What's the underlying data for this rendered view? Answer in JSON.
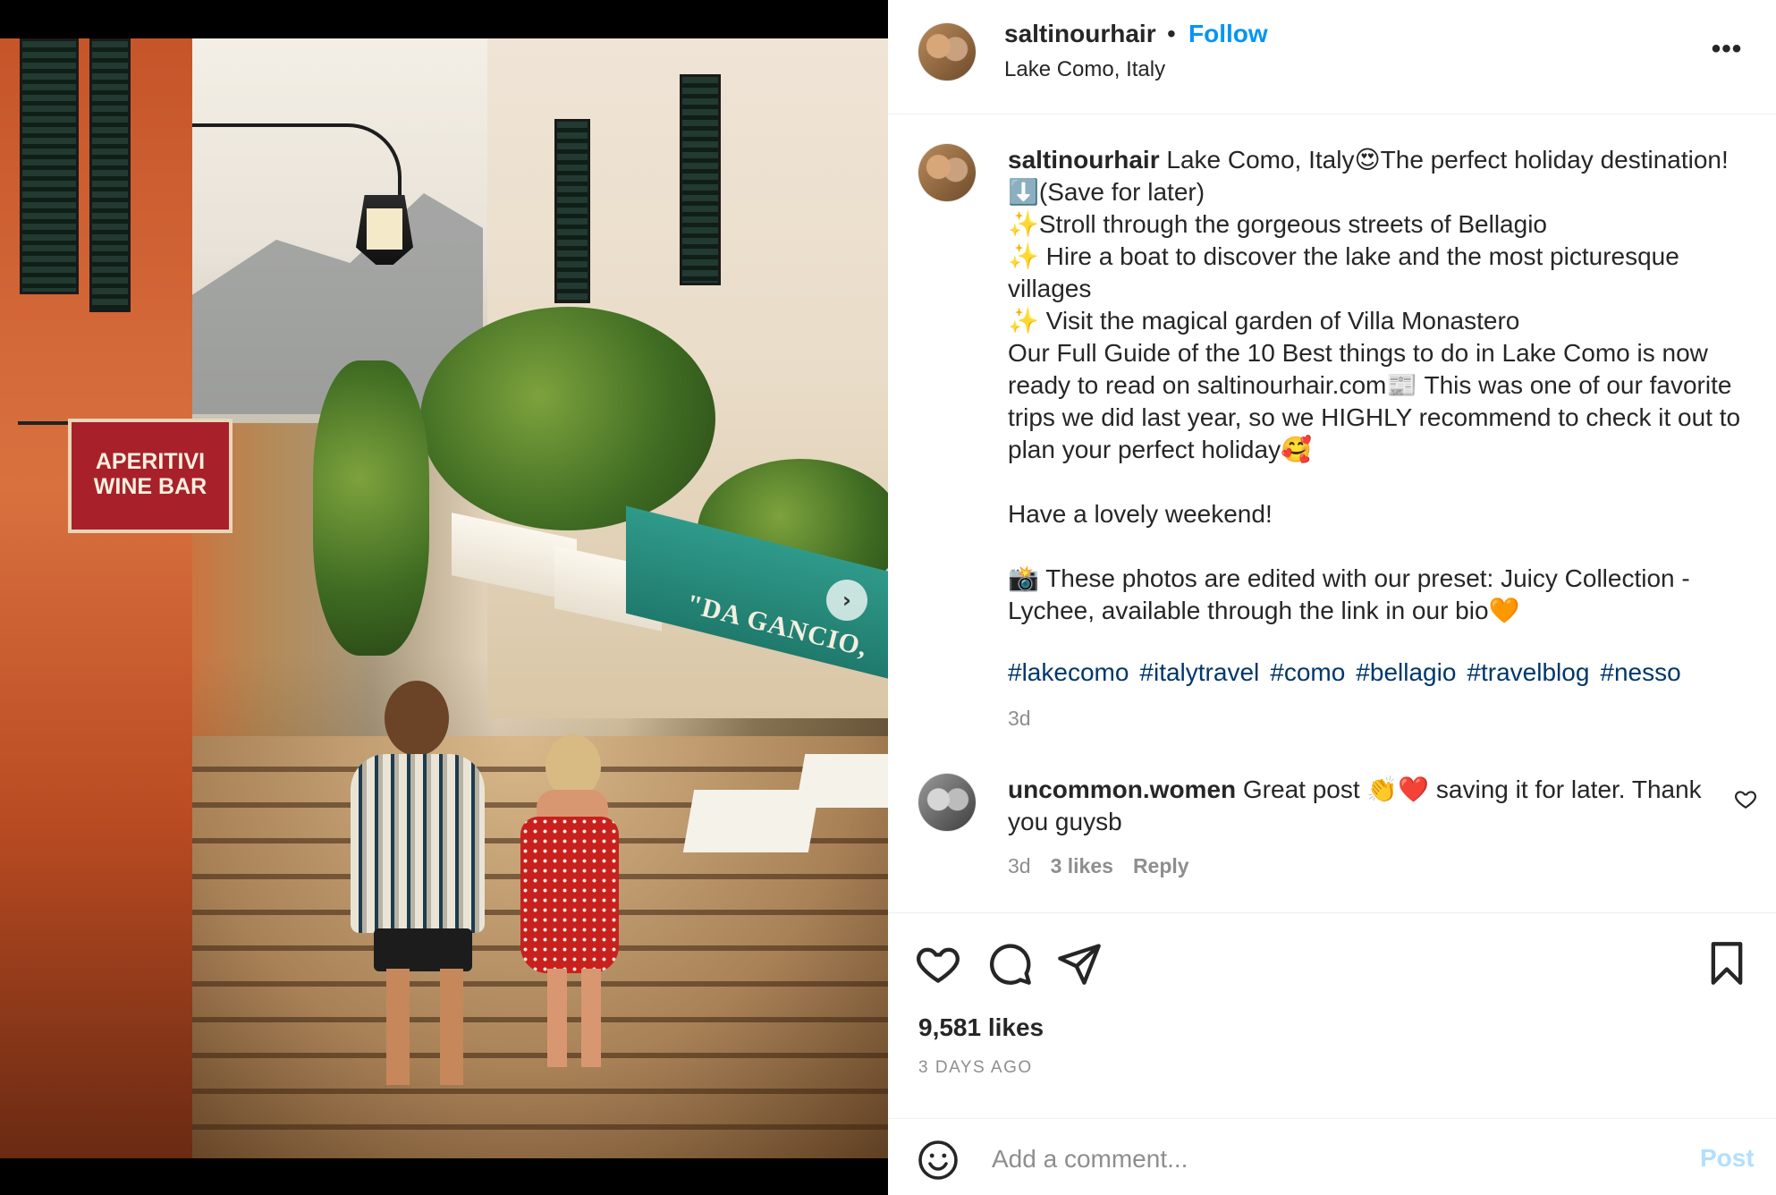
{
  "header": {
    "username": "saltinourhair",
    "separator": "•",
    "follow_label": "Follow",
    "location": "Lake Como, Italy",
    "more_label": "•••"
  },
  "photo": {
    "sign_text": "APERITIVI\nWINE BAR",
    "awning_text": "\"DA GANCIO,",
    "next_label": "›"
  },
  "caption": {
    "username": "saltinourhair",
    "text": " Lake Como, Italy😍The perfect holiday destination!⬇️(Save for later)\n✨Stroll through the gorgeous streets of Bellagio\n✨ Hire a boat to discover the lake and the most picturesque villages\n✨ Visit the magical garden of Villa Monastero\nOur Full Guide of the 10 Best things to do in Lake Como is now ready to read on saltinourhair.com📰 This was one of our favorite trips we did last year, so we HIGHLY recommend to check it out to plan your perfect holiday🥰\n\nHave a lovely weekend!\n\n📸 These photos are edited with our preset: Juicy Collection - Lychee, available through the link in our bio🧡",
    "hashtags": [
      "#lakecomo",
      "#italytravel",
      "#como",
      "#bellagio",
      "#travelblog",
      "#nesso"
    ],
    "time": "3d"
  },
  "comment": {
    "username": "uncommon.women",
    "text": " Great post 👏❤️ saving it for later. Thank you guysb",
    "time": "3d",
    "likes": "3 likes",
    "reply_label": "Reply"
  },
  "actions": {
    "likes": "9,581 likes",
    "ago": "3 DAYS AGO"
  },
  "add_comment": {
    "placeholder": "Add a comment...",
    "post_label": "Post"
  },
  "colors": {
    "accent": "#0095f6",
    "hashtag": "#00376b",
    "muted": "#8e8e8e",
    "post_disabled": "#b2dffc"
  }
}
